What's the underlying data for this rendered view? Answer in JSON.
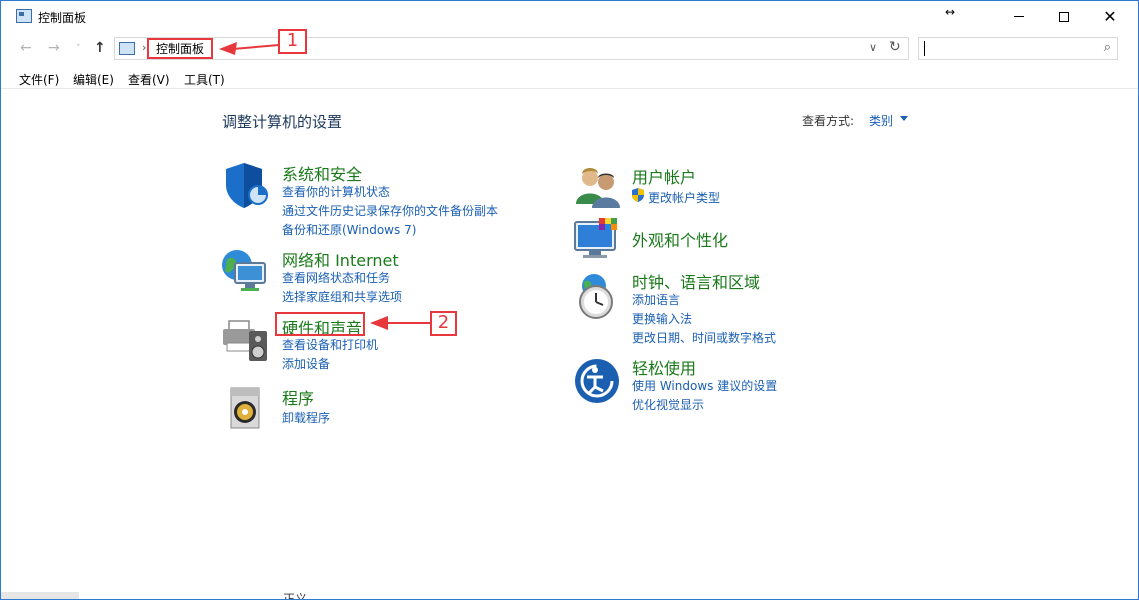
{
  "window": {
    "title": "控制面板",
    "resize_glyph": "↔"
  },
  "address": {
    "crumb": "控制面板",
    "separator": "›",
    "nav_back": "←",
    "nav_forward": "→",
    "nav_recent": "˅",
    "nav_up": "↑",
    "dropdown": "∨",
    "refresh": "↻",
    "search_placeholder": ""
  },
  "menu": [
    {
      "label": "文件(F)"
    },
    {
      "label": "编辑(E)"
    },
    {
      "label": "查看(V)"
    },
    {
      "label": "工具(T)"
    }
  ],
  "content": {
    "heading": "调整计算机的设置",
    "view_label": "查看方式:",
    "view_value": "类别"
  },
  "categories_left": [
    {
      "title": "系统和安全",
      "icon": "shield-icon",
      "links": [
        "查看你的计算机状态",
        "通过文件历史记录保存你的文件备份副本",
        "备份和还原(Windows 7)"
      ]
    },
    {
      "title": "网络和 Internet",
      "icon": "network-globe-icon",
      "links": [
        "查看网络状态和任务",
        "选择家庭组和共享选项"
      ]
    },
    {
      "title": "硬件和声音",
      "icon": "printer-speaker-icon",
      "links": [
        "查看设备和打印机",
        "添加设备"
      ]
    },
    {
      "title": "程序",
      "icon": "program-disk-icon",
      "links": [
        "卸载程序"
      ]
    }
  ],
  "categories_right": [
    {
      "title": "用户帐户",
      "icon": "users-icon",
      "links": [
        "更改帐户类型"
      ]
    },
    {
      "title": "外观和个性化",
      "icon": "monitor-palette-icon",
      "links": []
    },
    {
      "title": "时钟、语言和区域",
      "icon": "clock-globe-icon",
      "links": [
        "添加语言",
        "更换输入法",
        "更改日期、时间或数字格式"
      ]
    },
    {
      "title": "轻松使用",
      "icon": "ease-of-access-icon",
      "links": [
        "使用 Windows 建议的设置",
        "优化视觉显示"
      ]
    }
  ],
  "annotations": [
    {
      "label": "1"
    },
    {
      "label": "2"
    }
  ],
  "colors": {
    "annotation": "#e8383d",
    "link": "#1a5fb4",
    "category": "#1a7a1a",
    "heading": "#1e395b"
  },
  "stray_text": "正义"
}
